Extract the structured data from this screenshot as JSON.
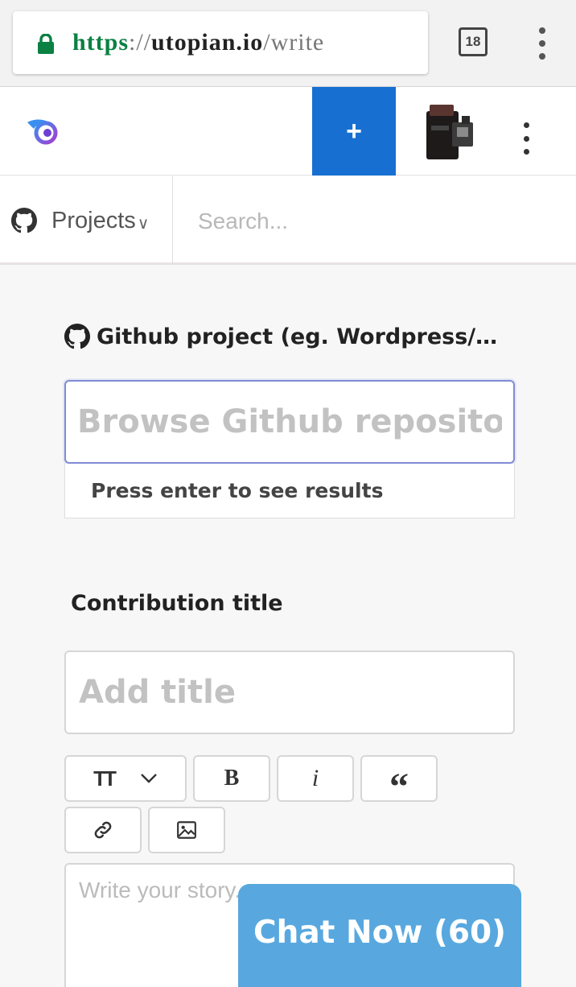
{
  "browser": {
    "url_scheme": "https",
    "url_separator": "://",
    "url_host": "utopian.io",
    "url_path": "/write",
    "tab_count": "18",
    "lock_icon": "lock-icon",
    "menu_icon": "vertical-dots-icon"
  },
  "header": {
    "logo_icon": "utopian-logo-icon",
    "new_post_label": "+",
    "menu_icon": "vertical-dots-icon",
    "accent_color": "#1770d1"
  },
  "nav": {
    "projects_label": "Projects",
    "projects_caret": "∨",
    "search_placeholder": "Search..."
  },
  "form": {
    "github_label": "Github project (eg. Wordpress/Wordpress)",
    "repo_placeholder": "Browse Github repositories",
    "repo_hint": "Press enter to see results",
    "title_label": "Contribution title",
    "title_placeholder": "Add title",
    "toolbar": {
      "size_label": "TT",
      "bold_label": "B",
      "italic_label": "i",
      "quote_label": "“"
    },
    "story_placeholder": "Write your story..."
  },
  "chat": {
    "label": "Chat Now (60)",
    "color": "#58a8df"
  }
}
